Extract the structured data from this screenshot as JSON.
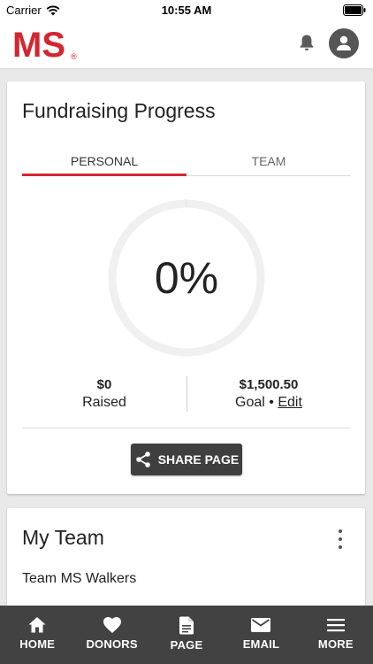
{
  "status_bar": {
    "carrier": "Carrier",
    "time": "10:55 AM"
  },
  "header": {
    "logo_text": "MS",
    "logo_mark": "®",
    "notification_icon": "bell-icon",
    "account_icon": "account-circle-icon"
  },
  "progress_card": {
    "title": "Fundraising Progress",
    "tabs": [
      {
        "label": "PERSONAL",
        "active": true
      },
      {
        "label": "TEAM",
        "active": false
      }
    ],
    "percent_text": "0%",
    "progress_fraction": 0,
    "raised": {
      "value": "$0",
      "label": "Raised"
    },
    "goal": {
      "value": "$1,500.50",
      "label": "Goal",
      "separator": "•",
      "edit_label": "Edit"
    },
    "share_button": {
      "label": "SHARE PAGE",
      "icon": "share-icon"
    }
  },
  "team_card": {
    "title": "My Team",
    "team_name": "Team MS Walkers",
    "menu_icon": "more-vert-icon"
  },
  "bottom_nav": {
    "items": [
      {
        "label": "HOME",
        "icon": "home-icon"
      },
      {
        "label": "DONORS",
        "icon": "heart-icon"
      },
      {
        "label": "PAGE",
        "icon": "document-icon"
      },
      {
        "label": "EMAIL",
        "icon": "email-icon"
      },
      {
        "label": "MORE",
        "icon": "menu-icon"
      }
    ]
  },
  "colors": {
    "brand_red": "#d22630",
    "ring_track": "#f0f0f0",
    "nav_bg": "#424242",
    "button_bg": "#3f3f3f"
  }
}
